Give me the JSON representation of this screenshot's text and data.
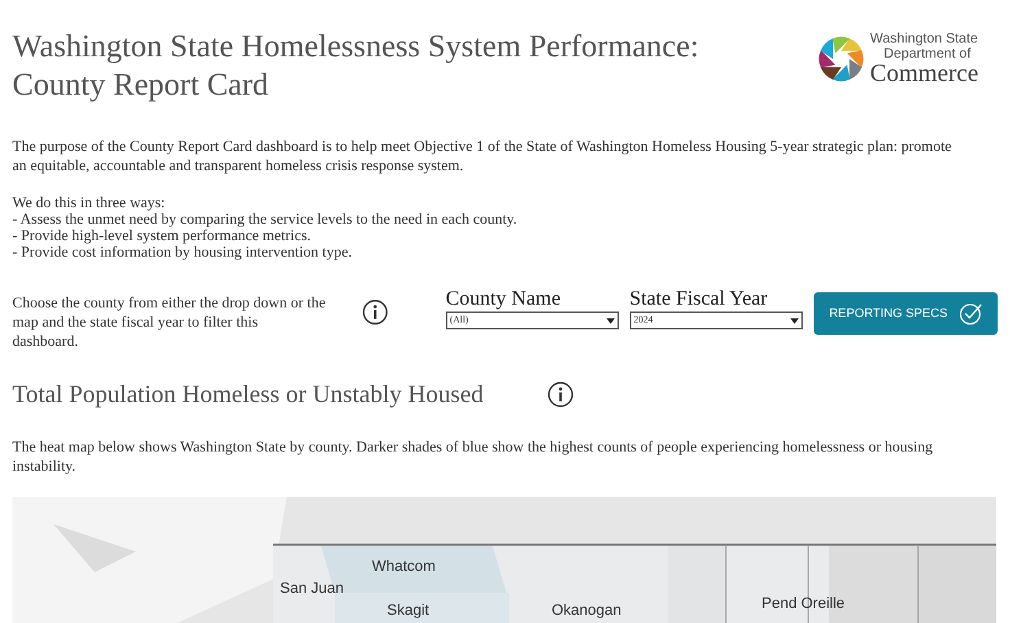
{
  "title": "Washington State Homelessness System Performance: County Report Card",
  "logo": {
    "lines": [
      "Washington State",
      "Department of",
      "Commerce"
    ]
  },
  "intro": "The purpose of the County Report Card dashboard is to help meet Objective 1 of the State of Washington Homeless Housing 5-year strategic plan: promote an equitable, accountable and transparent homeless crisis response system.",
  "ways_heading": "We do this in three ways:",
  "ways": [
    "- Assess the unmet need by comparing the service levels to the need in each county.",
    "- Provide high-level system performance metrics.",
    "- Provide cost information by housing intervention type."
  ],
  "filter_help": "Choose the county from either the drop down or the map and the state fiscal year to filter this dashboard.",
  "filters": [
    {
      "label": "County Name",
      "value": "(All)"
    },
    {
      "label": "State Fiscal Year",
      "value": "2024"
    }
  ],
  "specs_button": "REPORTING SPECS",
  "section_title": "Total Population Homeless or Unstably Housed",
  "section_text": "The heat map below shows Washington State by county. Darker shades of blue show the highest counts of people experiencing homelessness or housing instability.",
  "map": {
    "labels": [
      "Whatcom",
      "San Juan",
      "Skagit",
      "Okanogan",
      "Pend Oreille"
    ]
  }
}
